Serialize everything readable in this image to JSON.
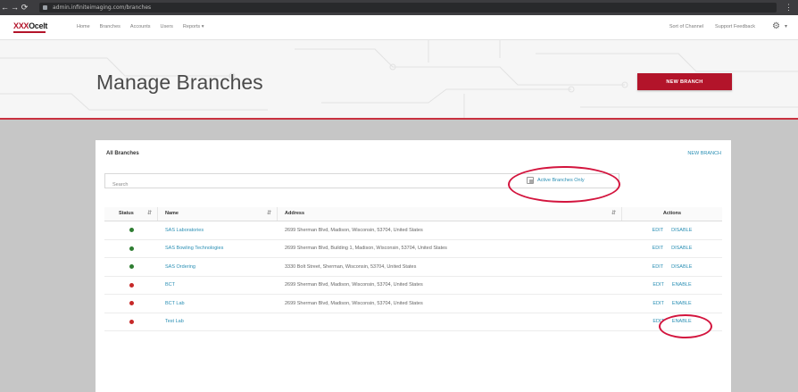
{
  "browser": {
    "back": "←",
    "forward": "→",
    "reload": "⟳",
    "home": "⌂",
    "url": "admin.infiniteimaging.com/branches",
    "menu": "⋮"
  },
  "header": {
    "logo_red": "XXX",
    "logo_dark": "Ocelt",
    "nav": [
      "Home",
      "Branches",
      "Accounts",
      "Users",
      "Reports ▾"
    ],
    "right_links": [
      "Sort of Channel",
      "Support Feedback"
    ],
    "gear": "⚙",
    "chevron": "▾"
  },
  "hero": {
    "title": "Manage Branches",
    "new_branch_label": "NEW BRANCH"
  },
  "card": {
    "title": "All Branches",
    "link": "NEW BRANCH",
    "search_placeholder": "Search",
    "active_only_label": "Active Branches Only"
  },
  "table": {
    "headers": {
      "status": "Status",
      "name": "Name",
      "address": "Address",
      "actions": "Actions"
    },
    "sort_icon": "⇵",
    "rows": [
      {
        "status": "active",
        "name": "SAS Laboratories",
        "address": "2699 Sherman Blvd, Madison, Wisconsin, 53704, United States",
        "edit": "EDIT",
        "disable": "DISABLE"
      },
      {
        "status": "active",
        "name": "SAS Bowling Technologies",
        "address": "2699 Sherman Blvd, Building 1, Madison, Wisconsin, 53704, United States",
        "edit": "EDIT",
        "disable": "DISABLE"
      },
      {
        "status": "active",
        "name": "SAS Ordering",
        "address": "3330 Bolt Street, Sherman, Wisconsin, 53704, United States",
        "edit": "EDIT",
        "disable": "DISABLE"
      },
      {
        "status": "inactive",
        "name": "BCT",
        "address": "2699 Sherman Blvd, Madison, Wisconsin, 53704, United States",
        "edit": "EDIT",
        "disable": "ENABLE"
      },
      {
        "status": "inactive",
        "name": "BCT Lab",
        "address": "2699 Sherman Blvd, Madison, Wisconsin, 53704, United States",
        "edit": "EDIT",
        "disable": "ENABLE"
      },
      {
        "status": "inactive",
        "name": "Test Lab",
        "address": "",
        "edit": "EDIT",
        "disable": "ENABLE"
      }
    ]
  },
  "colors": {
    "brand_red": "#b3142a",
    "link_blue": "#2a8fb4",
    "active_green": "#2e7d32",
    "inactive_red": "#c62828",
    "annotation_red": "#d3153e"
  }
}
